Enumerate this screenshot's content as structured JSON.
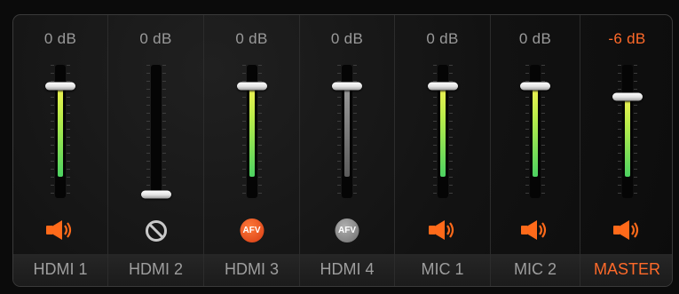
{
  "channels": [
    {
      "name": "HDMI 1",
      "gain": "0 dB",
      "fader_db": 0,
      "state": "speaker",
      "meter": "active"
    },
    {
      "name": "HDMI 2",
      "gain": "0 dB",
      "fader_db": null,
      "state": "muted",
      "meter": "none"
    },
    {
      "name": "HDMI 3",
      "gain": "0 dB",
      "fader_db": 0,
      "state": "afv-on",
      "meter": "active"
    },
    {
      "name": "HDMI 4",
      "gain": "0 dB",
      "fader_db": 0,
      "state": "afv-off",
      "meter": "inactive"
    },
    {
      "name": "MIC 1",
      "gain": "0 dB",
      "fader_db": 0,
      "state": "speaker",
      "meter": "active"
    },
    {
      "name": "MIC 2",
      "gain": "0 dB",
      "fader_db": 0,
      "state": "speaker",
      "meter": "active"
    },
    {
      "name": "MASTER",
      "gain": "-6 dB",
      "fader_db": -6,
      "state": "speaker",
      "meter": "active"
    }
  ],
  "afv_text": "AFV",
  "colors": {
    "accent": "#ff6a2a",
    "meter_top": "#f1f252",
    "meter_bottom": "#4cd261",
    "label_grey": "#9e9e9e"
  },
  "icons": [
    "speaker-icon",
    "mute-icon",
    "afv-icon"
  ]
}
